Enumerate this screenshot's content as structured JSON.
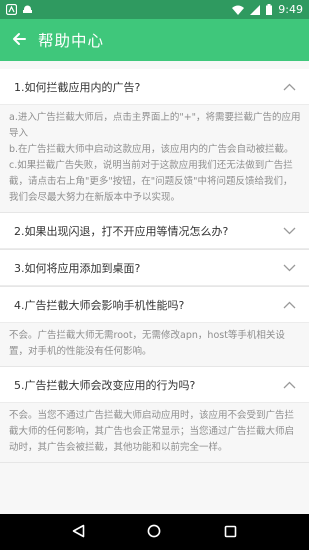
{
  "status_bar": {
    "time": "9:49"
  },
  "header": {
    "title": "帮助中心"
  },
  "faq": [
    {
      "question": "1.如何拦截应用内的广告?",
      "expanded": true,
      "answer": [
        "a.进入广告拦截大师后，点击主界面上的\"+\"，将需要拦截广告的应用导入",
        "b.在广告拦截大师中启动这款应用，该应用内的广告会自动被拦截。",
        "c.如果拦截广告失败，说明当前对于这款应用我们还无法做到广告拦截，请点击右上角\"更多\"按钮，在\"问题反馈\"中将问题反馈给我们，我们会尽最大努力在新版本中予以实现。"
      ]
    },
    {
      "question": "2.如果出现闪退，打不开应用等情况怎么办?",
      "expanded": false,
      "answer": []
    },
    {
      "question": "3.如何将应用添加到桌面?",
      "expanded": false,
      "answer": []
    },
    {
      "question": "4.广告拦截大师会影响手机性能吗?",
      "expanded": true,
      "answer": [
        "不会。广告拦截大师无需root，无需修改apn，host等手机相关设置，对手机的性能没有任何影响。"
      ]
    },
    {
      "question": "5.广告拦截大师会改变应用的行为吗?",
      "expanded": true,
      "answer": [
        "不会。当您不通过广告拦截大师启动应用时，该应用不会受到广告拦截大师的任何影响，其广告也会正常显示；当您通过广告拦截大师启动时，其广告会被拦截，其他功能和以前完全一样。"
      ]
    }
  ],
  "icons": {
    "back": "arrow-left-icon",
    "expand": "chevron-down-icon",
    "collapse": "chevron-up-icon",
    "nav_back": "triangle-back-icon",
    "nav_home": "circle-home-icon",
    "nav_recents": "square-recents-icon"
  },
  "colors": {
    "status_bar": "#2f9a60",
    "app_bar": "#3fc77b",
    "answer_text": "#8e8e8e"
  }
}
